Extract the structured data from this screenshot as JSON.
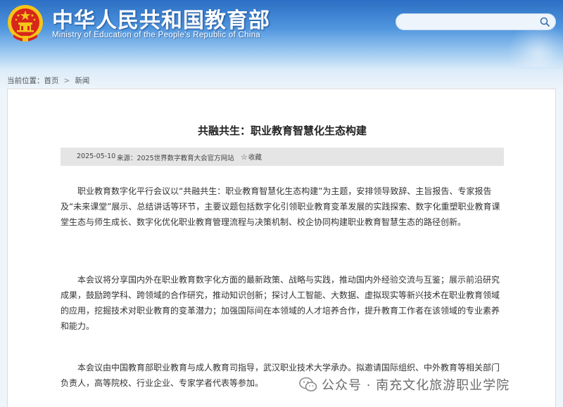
{
  "header": {
    "title": "中华人民共和国教育部",
    "subtitle": "Ministry of Education of the People's Republic of China",
    "emblem_icon": "national-emblem-icon",
    "search": {
      "placeholder": "",
      "icon": "search-icon"
    }
  },
  "breadcrumb": {
    "prefix": "当前位置：",
    "home": "首页",
    "separator": ">",
    "current": "新闻"
  },
  "article": {
    "title": "共融共生：职业教育智慧化生态构建",
    "date": "2025-05-10",
    "source": "来源：2025世界数字教育大会官方网站",
    "favorite_label": "收藏",
    "favorite_icon": "star-icon",
    "paragraphs": [
      "职业教育数字化平行会议以“共融共生：职业教育智慧化生态构建”为主题，安排领导致辞、主旨报告、专家报告及“未来课堂”展示、总结讲话等环节，主要议题包括数字化引领职业教育变革发展的实践探索、数字化重塑职业教育课堂生态与师生成长、数字化优化职业教育管理流程与决策机制、校企协同构建职业教育智慧生态的路径创新。",
      "本会议将分享国内外在职业教育数字化方面的最新政策、战略与实践，推动国内外经验交流与互鉴；展示前沿研究成果，鼓励跨学科、跨领域的合作研究，推动知识创新；探讨人工智能、大数据、虚拟现实等新兴技术在职业教育领域的应用，挖掘技术对职业教育的变革潜力；加强国际间在本领域的人才培养合作，提升教育工作者在该领域的专业素养和能力。",
      "本会议由中国教育部职业教育与成人教育司指导，武汉职业技术大学承办。拟邀请国际组织、中外教育等相关部门负责人，高等院校、行业企业、专家学者代表等参加。"
    ]
  },
  "watermark": {
    "text": "公众号 · 南充文化旅游职业学院",
    "icon": "wechat-icon"
  },
  "colors": {
    "header_blue": "#2c6fc4",
    "emblem_red": "#d8261c",
    "emblem_gold": "#f5c518",
    "meta_bar_bg": "#e5e5e5"
  }
}
